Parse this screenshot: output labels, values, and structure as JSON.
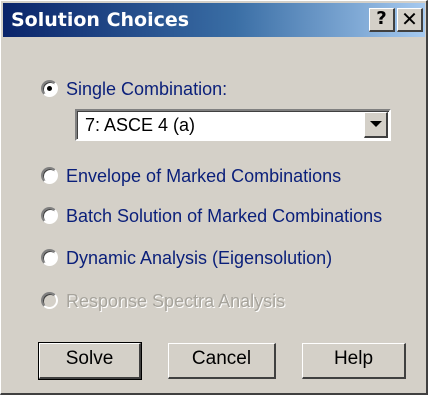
{
  "window": {
    "title": "Solution Choices",
    "help_glyph": "?",
    "close_glyph": "✕"
  },
  "options": {
    "single": "Single Combination:",
    "envelope": "Envelope of Marked Combinations",
    "batch": "Batch Solution of Marked Combinations",
    "dynamic": "Dynamic Analysis (Eigensolution)",
    "response": "Response Spectra Analysis"
  },
  "selected_option": "single",
  "combination": {
    "value": "7: ASCE 4 (a)"
  },
  "buttons": {
    "solve": "Solve",
    "cancel": "Cancel",
    "help": "Help"
  },
  "colors": {
    "title_bar": "#0a246a",
    "label_text": "#0a1f7a",
    "disabled_text": "#a7a49c",
    "face": "#d4d0c8"
  }
}
